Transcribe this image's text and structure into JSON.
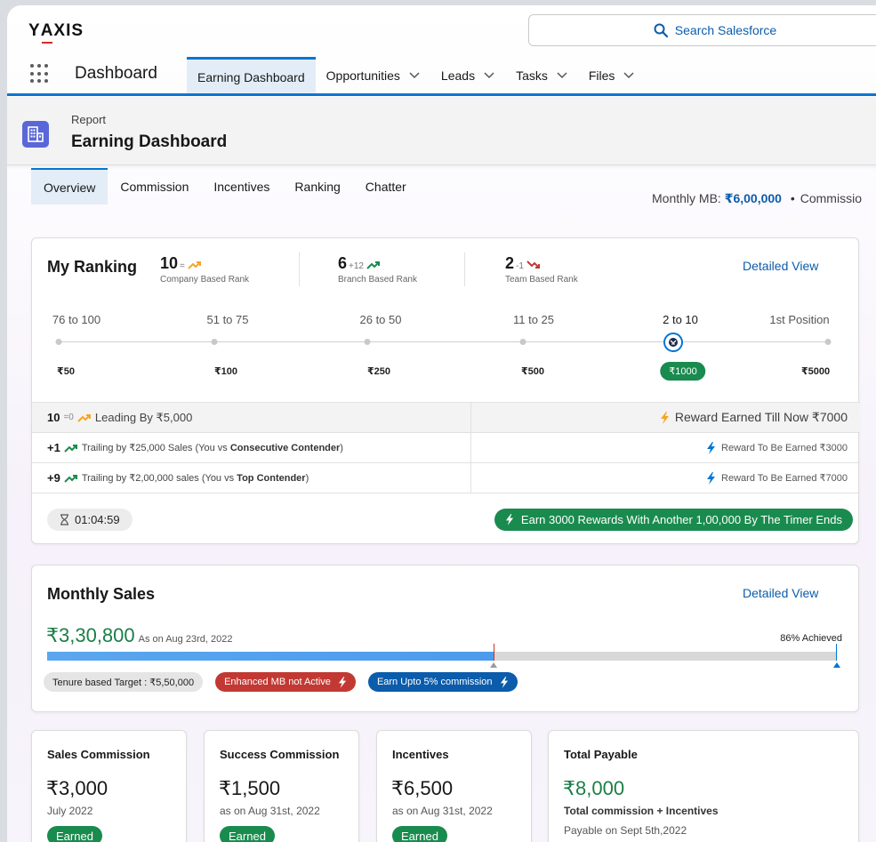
{
  "brand": {
    "logo_text_1": "Y",
    "logo_text_a": "A",
    "logo_text_2": "XIS"
  },
  "search": {
    "label": "Search Salesforce"
  },
  "nav": {
    "app_name": "Dashboard",
    "tabs": [
      {
        "label": "Earning Dashboard",
        "active": true,
        "dropdown": false
      },
      {
        "label": "Opportunities",
        "dropdown": true
      },
      {
        "label": "Leads",
        "dropdown": true
      },
      {
        "label": "Tasks",
        "dropdown": true
      },
      {
        "label": "Files",
        "dropdown": true
      }
    ]
  },
  "page_header": {
    "subtitle": "Report",
    "title": "Earning Dashboard"
  },
  "subtabs": [
    "Overview",
    "Commission",
    "Incentives",
    "Ranking",
    "Chatter"
  ],
  "summary": {
    "monthly_mb_label": "Monthly MB: ",
    "monthly_mb_value": "₹6,00,000",
    "separator": "•",
    "commission_label": "Commissio"
  },
  "ranking": {
    "title": "My Ranking",
    "detail_link": "Detailed View",
    "ranks": [
      {
        "value": "10",
        "delta": "=",
        "label": "Company Based Rank",
        "trend": "flat"
      },
      {
        "value": "6",
        "delta": "+12",
        "label": "Branch Based Rank",
        "trend": "up"
      },
      {
        "value": "2",
        "delta": "-1",
        "label": "Team Based Rank",
        "trend": "down"
      }
    ],
    "tiers": [
      {
        "range": "76 to 100",
        "reward": "₹50"
      },
      {
        "range": "51 to 75",
        "reward": "₹100"
      },
      {
        "range": "26 to 50",
        "reward": "₹250"
      },
      {
        "range": "11 to 25",
        "reward": "₹500"
      },
      {
        "range": "2 to 10",
        "reward": "₹1000",
        "current": true
      },
      {
        "range": "1st Position",
        "reward": "₹5000"
      }
    ],
    "rows": [
      {
        "rank": "10",
        "delta": "=0",
        "text": "Leading By ₹5,000",
        "reward": "Reward Earned Till Now ₹7000"
      },
      {
        "rank": "+1",
        "text_pre": "Trailing by ₹25,000 Sales (You vs ",
        "text_bold": "Consecutive Contender",
        "text_post": ")",
        "reward": "Reward To Be Earned ₹3000"
      },
      {
        "rank": "+9",
        "text_pre": "Trailing by ₹2,00,000 sales (You vs ",
        "text_bold": "Top Contender",
        "text_post": ")",
        "reward": "Reward To Be Earned ₹7000"
      }
    ],
    "timer": "01:04:59",
    "cta": "Earn 3000 Rewards With Another 1,00,000 By The Timer Ends"
  },
  "monthly_sales": {
    "title": "Monthly Sales",
    "detail_link": "Detailed View",
    "amount": "₹3,30,800",
    "as_on": "As on Aug 23rd, 2022",
    "achieved": "86% Achieved",
    "progress_fraction": 0.565,
    "pills": [
      {
        "label": "Tenure based Target : ₹5,50,000",
        "style": "grey"
      },
      {
        "label": "Enhanced MB not Active",
        "style": "red",
        "bolt": true
      },
      {
        "label": "Earn Upto 5% commission",
        "style": "blue",
        "bolt": true
      }
    ]
  },
  "summary_cards": [
    {
      "title": "Sales Commission",
      "value": "₹3,000",
      "sub": "July 2022",
      "badge": "Earned"
    },
    {
      "title": "Success Commission",
      "value": "₹1,500",
      "sub": "as on Aug 31st, 2022",
      "badge": "Earned"
    },
    {
      "title": "Incentives",
      "value": "₹6,500",
      "sub": "as on Aug 31st, 2022",
      "badge": "Earned"
    },
    {
      "title": "Total Payable",
      "value": "₹8,000",
      "sub": "Total commission + Incentives",
      "sub2": "Payable on Sept 5th,2022"
    }
  ],
  "colors": {
    "brand_blue": "#0176d3",
    "link_blue": "#0b5cab",
    "success_green": "#1a8b4e",
    "alert_red": "#c23934",
    "logo_red": "#d52a2a"
  }
}
